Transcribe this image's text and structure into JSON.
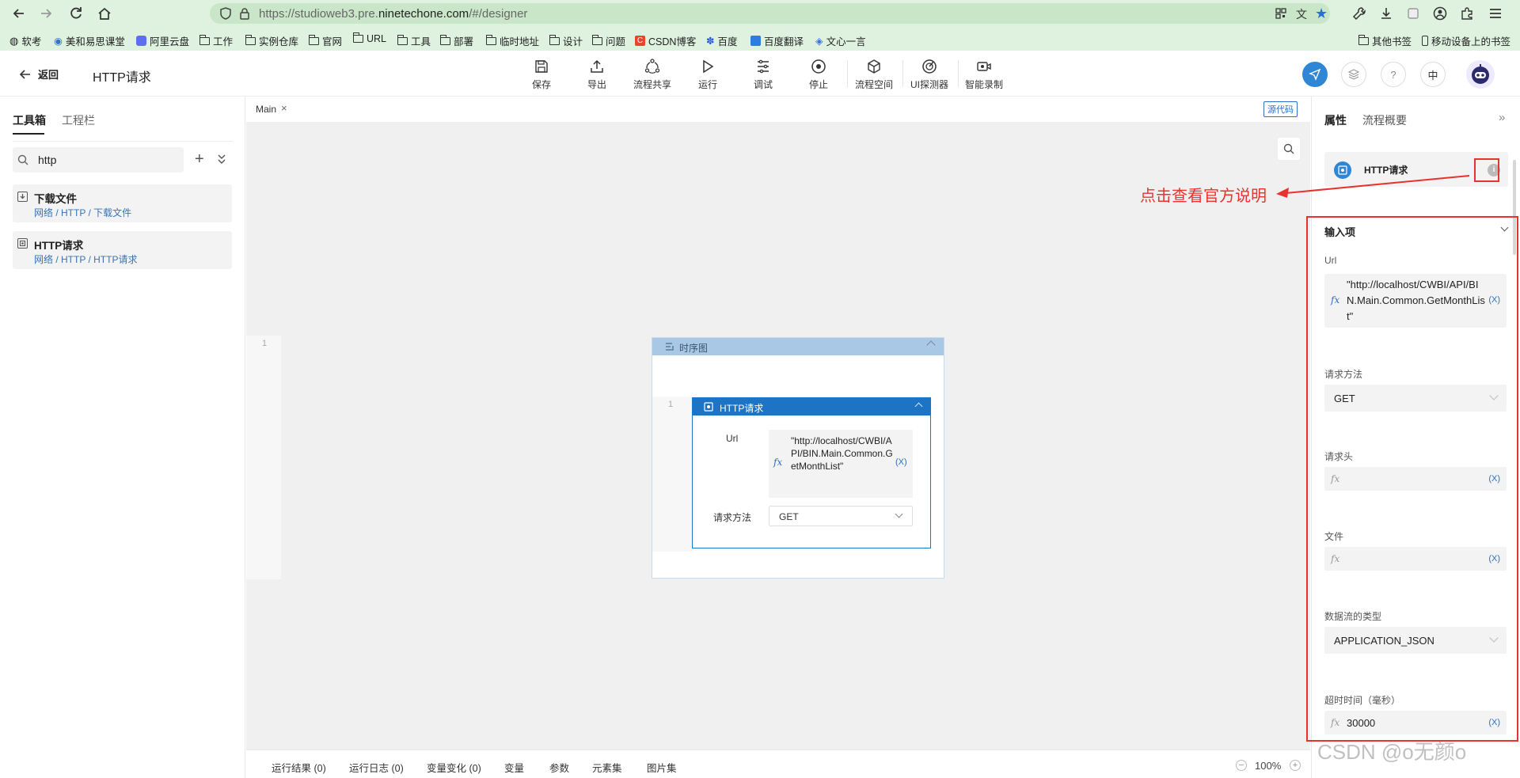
{
  "browser": {
    "url_prefix": "https://studioweb3.pre.",
    "url_domain": "ninetechone.com",
    "url_path": "/#/designer",
    "bookmarks": [
      "软考",
      "美和易思课堂",
      "阿里云盘",
      "工作",
      "实例仓库",
      "官网",
      "URL",
      "工具",
      "部署",
      "临时地址",
      "设计",
      "问题",
      "CSDN博客",
      "百度",
      "百度翻译",
      "文心一言"
    ],
    "bookmarks_right": [
      "其他书签",
      "移动设备上的书签"
    ]
  },
  "header": {
    "back_label": "返回",
    "title": "HTTP请求",
    "tools": [
      "保存",
      "导出",
      "流程共享",
      "运行",
      "调试",
      "停止",
      "流程空间",
      "UI探测器",
      "智能录制"
    ],
    "lang": "中"
  },
  "left": {
    "tabs": [
      "工具箱",
      "工程栏"
    ],
    "search_value": "http",
    "results": [
      {
        "title": "下载文件",
        "path": "网络 / HTTP / 下载文件"
      },
      {
        "title": "HTTP请求",
        "path": "网络 / HTTP / HTTP请求"
      }
    ]
  },
  "canvas": {
    "tab": "Main",
    "source_btn": "源代码",
    "outer_line": "1",
    "inner_line": "1",
    "sequence_title": "时序图",
    "activity_title": "HTTP请求",
    "url_label": "Url",
    "url_value": "\"http://localhost/CWBI/API/BIN.Main.Common.GetMonthList\"",
    "method_label": "请求方法",
    "method_value": "GET",
    "fx": "fx",
    "var_btn": "(X)"
  },
  "right": {
    "tabs": [
      "属性",
      "流程概要"
    ],
    "activity_name": "HTTP请求",
    "section": "输入项",
    "url_label": "Url",
    "url_value": "\"http://localhost/CWBI/API/BIN.Main.Common.GetMonthList\"",
    "method_label": "请求方法",
    "method_value": "GET",
    "headers_label": "请求头",
    "file_label": "文件",
    "stream_label": "数据流的类型",
    "stream_value": "APPLICATION_JSON",
    "timeout_label": "超时时间（毫秒）",
    "timeout_value": "30000"
  },
  "annotation": {
    "text": "点击查看官方说明",
    "color": "#e8322e"
  },
  "bottom": {
    "tabs": [
      "运行结果 (0)",
      "运行日志 (0)",
      "变量变化 (0)",
      "变量",
      "参数",
      "元素集",
      "图片集"
    ],
    "zoom": "100%"
  },
  "watermark": "CSDN @o无颜o"
}
